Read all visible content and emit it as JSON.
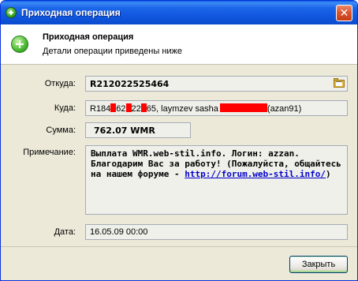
{
  "window": {
    "title": "Приходная операция",
    "close_icon": "close-icon"
  },
  "header": {
    "icon": "plus-circle-icon",
    "title": "Приходная операция",
    "subtitle": "Детали операции приведены ниже"
  },
  "form": {
    "from_label": "Откуда:",
    "from_value": "R212022525464",
    "from_icon": "folder-icon",
    "to_label": "Куда:",
    "to_parts": [
      "R184",
      "62",
      "22",
      "65, laymzev sasha",
      "(azan91)"
    ],
    "sum_label": "Сумма:",
    "sum_value": "762.07 WMR",
    "note_label": "Примечание:",
    "note_text": "Выплата WMR.web-stil.info. Логин: azzan. Благодарим Вас за работу! (Пожалуйста, общайтесь на нашем форуме - ",
    "note_link": "http://forum.web-stil.info/",
    "note_tail": ")",
    "date_label": "Дата:",
    "date_value": "16.05.09 00:00"
  },
  "footer": {
    "close_button": "Закрыть"
  },
  "colors": {
    "titlebar": "#0f55dd",
    "redaction": "#ff0000",
    "link": "#0000cc"
  }
}
